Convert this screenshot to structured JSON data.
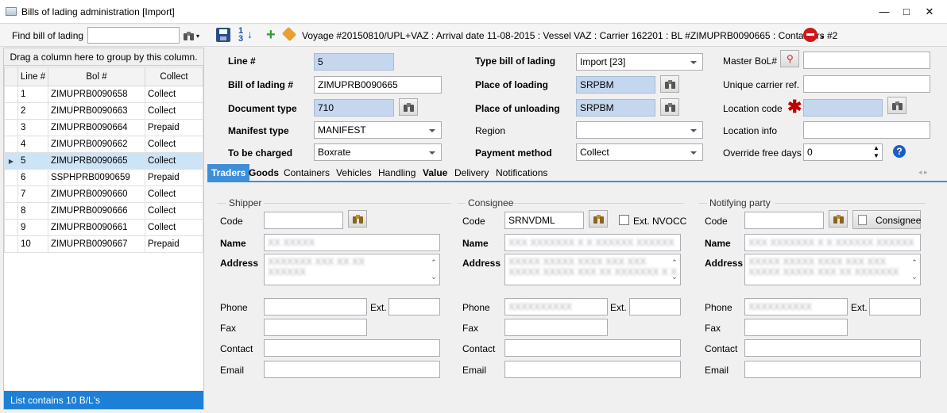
{
  "window": {
    "title": "Bills of lading administration [Import]",
    "minimize": "—",
    "maximize": "□",
    "close": "✕"
  },
  "toolbar": {
    "find_label": "Find bill of lading",
    "find_value": "",
    "voyage_info": "Voyage #20150810/UPL+VAZ : Arrival date 11-08-2015 : Vessel VAZ : Carrier 162201 : BL #ZIMUPRB0090665 : Containers #2"
  },
  "grid": {
    "group_hint": "Drag a column here to group by this column.",
    "columns": [
      "Line #",
      "Bol #",
      "Collect"
    ],
    "rows": [
      [
        "1",
        "ZIMUPRB0090658",
        "Collect"
      ],
      [
        "2",
        "ZIMUPRB0090663",
        "Collect"
      ],
      [
        "3",
        "ZIMUPRB0090664",
        "Prepaid"
      ],
      [
        "4",
        "ZIMUPRB0090662",
        "Collect"
      ],
      [
        "5",
        "ZIMUPRB0090665",
        "Collect"
      ],
      [
        "6",
        "SSPHPRB0090659",
        "Prepaid"
      ],
      [
        "7",
        "ZIMUPRB0090660",
        "Collect"
      ],
      [
        "8",
        "ZIMUPRB0090666",
        "Collect"
      ],
      [
        "9",
        "ZIMUPRB0090661",
        "Collect"
      ],
      [
        "10",
        "ZIMUPRB0090667",
        "Prepaid"
      ]
    ],
    "selected_index": 4,
    "status": "List contains 10 B/L's"
  },
  "form": {
    "line_label": "Line #",
    "line_value": "5",
    "bol_label": "Bill of lading #",
    "bol_value": "ZIMUPRB0090665",
    "doctype_label": "Document type",
    "doctype_value": "710",
    "manifest_label": "Manifest type",
    "manifest_value": "MANIFEST",
    "charged_label": "To be charged",
    "charged_value": "Boxrate",
    "typebol_label": "Type bill of lading",
    "typebol_value": "Import [23]",
    "loading_label": "Place of loading",
    "loading_value": "SRPBM",
    "unloading_label": "Place of unloading",
    "unloading_value": "SRPBM",
    "region_label": "Region",
    "region_value": "",
    "payment_label": "Payment method",
    "payment_value": "Collect",
    "master_label": "Master BoL#",
    "master_value": "",
    "carrier_label": "Unique carrier ref.",
    "carrier_value": "",
    "location_label": "Location code",
    "location_value": "",
    "locinfo_label": "Location info",
    "locinfo_value": "",
    "freedays_label": "Override free days",
    "freedays_value": "0"
  },
  "tabs": [
    "Traders",
    "Goods",
    "Containers",
    "Vehicles",
    "Handling",
    "Value",
    "Delivery",
    "Notifications"
  ],
  "traders": {
    "labels": {
      "code": "Code",
      "name": "Name",
      "address": "Address",
      "phone": "Phone",
      "ext": "Ext.",
      "fax": "Fax",
      "contact": "Contact",
      "email": "Email"
    },
    "shipper": {
      "title": "Shipper",
      "code": "",
      "name": "XX XXXXX",
      "address1": "XXXXXXX XXX XX XX",
      "address2": "XXXXXX",
      "phone": "",
      "ext": "",
      "fax": "",
      "contact": "",
      "email": ""
    },
    "consignee": {
      "title": "Consignee",
      "code": "SRNVDML",
      "ext_nvocc": "Ext. NVOCC",
      "name": "XXX XXXXXXX X X XXXXXX XXXXXX",
      "address1": "XXXXX XXXXX XXXX XXX XXX",
      "address2": "XXXXX XXXXX XXX XX XXXXXXX X X",
      "phone": "XXXXXXXXXX",
      "ext": "",
      "fax": "",
      "contact": "",
      "email": ""
    },
    "notify": {
      "title": "Notifying party",
      "code": "",
      "consignee_btn": "Consignee",
      "name": "XXX XXXXXXX X X XXXXXX XXXXXX",
      "address1": "XXXXX XXXXX XXXX XXX XXX",
      "address2": "XXXXX XXXXX XXX XX XXXXXXX",
      "phone": "XXXXXXXXXX",
      "ext": "",
      "fax": "",
      "contact": "",
      "email": ""
    }
  },
  "colors": {
    "accent": "#3c8fd8",
    "status_bar": "#1e7fd6",
    "readonly_field": "#c5d7ee",
    "required": "#c00000"
  }
}
